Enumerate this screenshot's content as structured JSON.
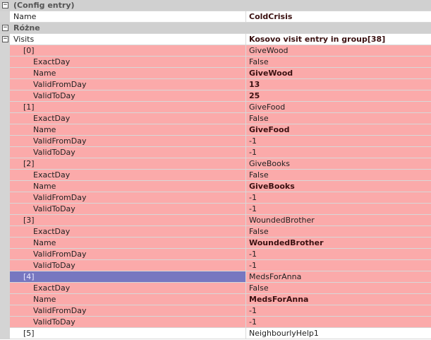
{
  "categories": {
    "config": "(Config entry)",
    "rozne": "Różne"
  },
  "config_name": {
    "label": "Name",
    "value": "ColdCrisis"
  },
  "visits": {
    "label": "Visits",
    "value": "Kosovo visit entry in group[38]"
  },
  "field_labels": {
    "exact_day": "ExactDay",
    "name": "Name",
    "valid_from": "ValidFromDay",
    "valid_to": "ValidToDay"
  },
  "entries": [
    {
      "index": "[0]",
      "summary": "GiveWood",
      "exact_day": "False",
      "name": "GiveWood",
      "valid_from": "13",
      "valid_to": "25"
    },
    {
      "index": "[1]",
      "summary": "GiveFood",
      "exact_day": "False",
      "name": "GiveFood",
      "valid_from": "-1",
      "valid_to": "-1"
    },
    {
      "index": "[2]",
      "summary": "GiveBooks",
      "exact_day": "False",
      "name": "GiveBooks",
      "valid_from": "-1",
      "valid_to": "-1"
    },
    {
      "index": "[3]",
      "summary": "WoundedBrother",
      "exact_day": "False",
      "name": "WoundedBrother",
      "valid_from": "-1",
      "valid_to": "-1"
    },
    {
      "index": "[4]",
      "summary": "MedsForAnna",
      "exact_day": "False",
      "name": "MedsForAnna",
      "valid_from": "-1",
      "valid_to": "-1"
    }
  ],
  "collapsed_entry": {
    "index": "[5]",
    "summary": "NeighbourlyHelp1"
  },
  "expander": {
    "expanded": "−",
    "collapsed": "+"
  }
}
